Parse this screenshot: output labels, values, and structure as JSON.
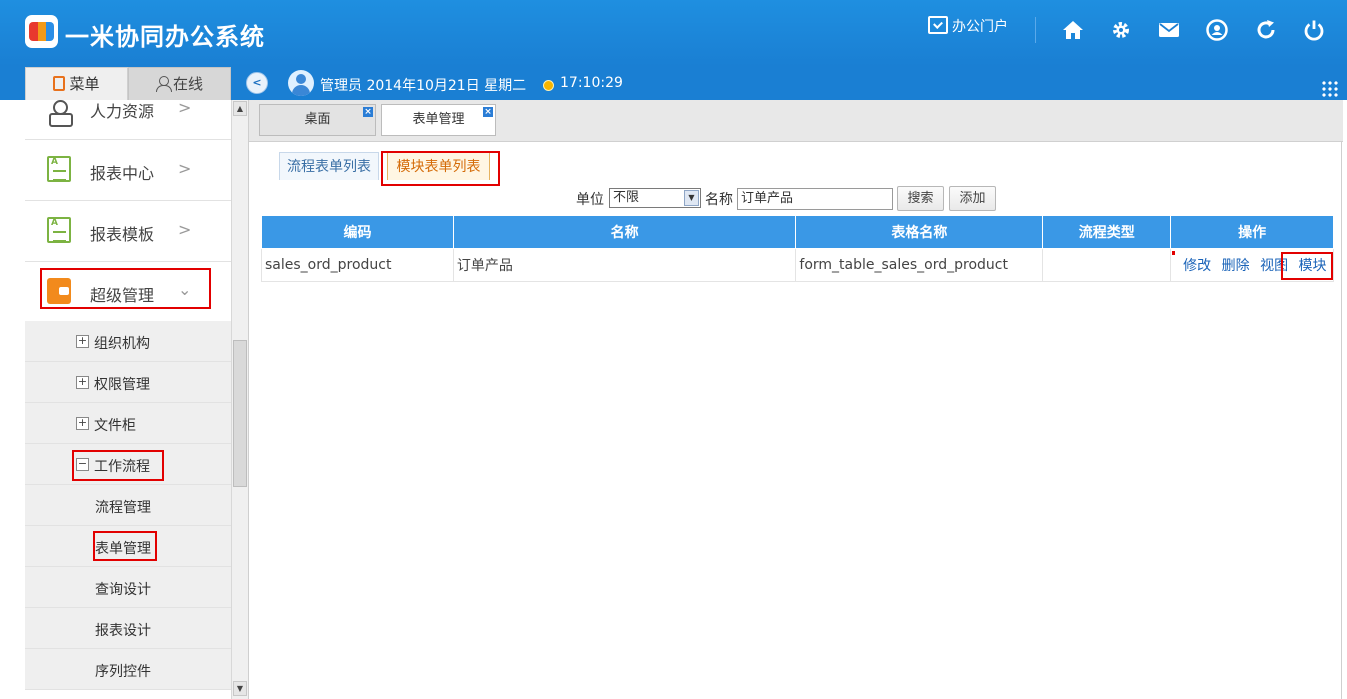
{
  "header": {
    "app_title": "一米协同办公系统",
    "portal_label": "办公门户",
    "icons": [
      "home-icon",
      "gear-icon",
      "mail-icon",
      "user-circle-icon",
      "refresh-icon",
      "power-icon"
    ]
  },
  "subheader": {
    "tab_menu": "菜单",
    "tab_online": "在线",
    "user_info": "管理员 2014年10月21日 星期二",
    "time": "17:10:29"
  },
  "sidebar": {
    "main_items": [
      {
        "label": "人力资源",
        "icon": "person-icon"
      },
      {
        "label": "报表中心",
        "icon": "report-icon"
      },
      {
        "label": "报表模板",
        "icon": "template-icon"
      },
      {
        "label": "超级管理",
        "icon": "wallet-icon"
      }
    ],
    "sub_items": [
      {
        "label": "组织机构",
        "expander": "+"
      },
      {
        "label": "权限管理",
        "expander": "+"
      },
      {
        "label": "文件柜",
        "expander": "+"
      },
      {
        "label": "工作流程",
        "expander": "−"
      },
      {
        "label": "流程管理"
      },
      {
        "label": "表单管理"
      },
      {
        "label": "查询设计"
      },
      {
        "label": "报表设计"
      },
      {
        "label": "序列控件"
      }
    ]
  },
  "doc_tabs": [
    "桌面",
    "表单管理"
  ],
  "sub_tabs": [
    "流程表单列表",
    "模块表单列表"
  ],
  "search": {
    "unit_label": "单位",
    "unit_value": "不限",
    "name_label": "名称",
    "name_value": "订单产品",
    "search_button": "搜索",
    "add_button": "添加"
  },
  "table": {
    "headers": [
      "编码",
      "名称",
      "表格名称",
      "流程类型",
      "操作"
    ],
    "rows": [
      {
        "code": "sales_ord_product",
        "name": "订单产品",
        "table_name": "form_table_sales_ord_product",
        "flow_type": "",
        "ops": [
          "修改",
          "删除",
          "视图",
          "模块"
        ]
      }
    ]
  },
  "colors": {
    "header_blue": "#1a7fd3",
    "table_header": "#3a98e6",
    "highlight_red": "#e20000",
    "active_subtab": "#d46b08"
  }
}
